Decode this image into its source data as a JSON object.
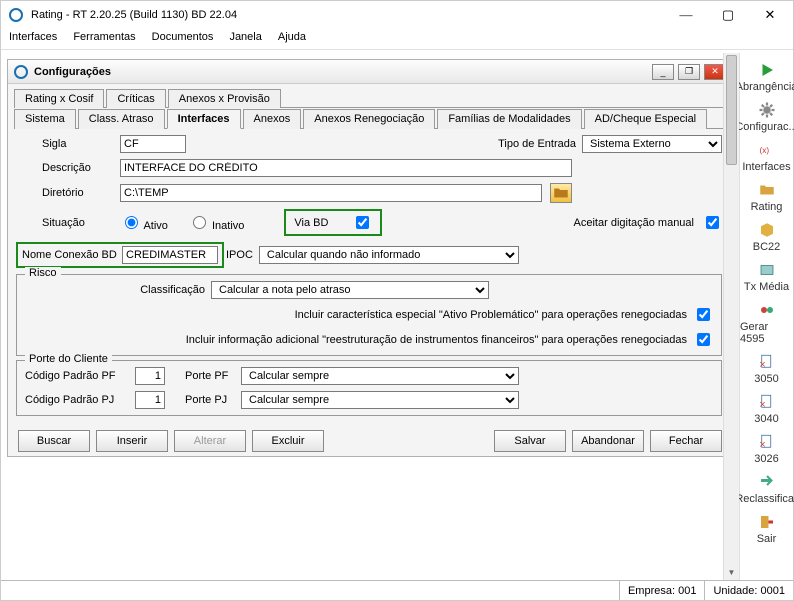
{
  "app": {
    "title": "Rating - RT 2.20.25 (Build 1130) BD 22.04"
  },
  "menus": [
    "Interfaces",
    "Ferramentas",
    "Documentos",
    "Janela",
    "Ajuda"
  ],
  "childTitle": "Configurações",
  "tabs1": [
    "Rating x Cosif",
    "Críticas",
    "Anexos x Provisão"
  ],
  "tabs2": [
    "Sistema",
    "Class. Atraso",
    "Interfaces",
    "Anexos",
    "Anexos Renegociação",
    "Famílias de Modalidades",
    "AD/Cheque Especial"
  ],
  "tabs2Active": "Interfaces",
  "form": {
    "siglaLbl": "Sigla",
    "sigla": "CF",
    "tipoEntradaLbl": "Tipo de Entrada",
    "tipoEntrada": "Sistema Externo",
    "descLbl": "Descrição",
    "desc": "INTERFACE DO CRÉDITO",
    "dirLbl": "Diretório",
    "dir": "C:\\TEMP",
    "sitLbl": "Situação",
    "ativo": "Ativo",
    "inativo": "Inativo",
    "viaBD": "Via BD",
    "aceitarManual": "Aceitar digitação manual",
    "nomeConLbl": "Nome Conexão BD",
    "nomeCon": "CREDIMASTER",
    "ipocLbl": "IPOC",
    "ipoc": "Calcular quando não informado",
    "riscoLegend": "Risco",
    "classifLbl": "Classificação",
    "classif": "Calcular a nota pelo atraso",
    "inc1": "Incluir característica especial \"Ativo Problemático\" para operações renegociadas",
    "inc2": "Incluir informação adicional \"reestruturação de instrumentos financeiros\" para operações renegociadas",
    "porteLegend": "Porte do Cliente",
    "codPF": "Código Padrão PF",
    "codPFv": "1",
    "portePF": "Porte PF",
    "portePFv": "Calcular sempre",
    "codPJ": "Código Padrão PJ",
    "codPJv": "1",
    "portePJ": "Porte PJ",
    "portePJv": "Calcular sempre"
  },
  "buttons": {
    "buscar": "Buscar",
    "inserir": "Inserir",
    "alterar": "Alterar",
    "excluir": "Excluir",
    "salvar": "Salvar",
    "abandonar": "Abandonar",
    "fechar": "Fechar"
  },
  "sidebar": [
    {
      "label": "Abrangência",
      "icon": "play"
    },
    {
      "label": "Configurac...",
      "icon": "gear"
    },
    {
      "label": "Interfaces",
      "icon": "io"
    },
    {
      "label": "Rating",
      "icon": "folder"
    },
    {
      "label": "BC22",
      "icon": "cube"
    },
    {
      "label": "Tx Média",
      "icon": "tx"
    },
    {
      "label": "Gerar 4595",
      "icon": "gen"
    },
    {
      "label": "3050",
      "icon": "doc"
    },
    {
      "label": "3040",
      "icon": "doc"
    },
    {
      "label": "3026",
      "icon": "doc"
    },
    {
      "label": "Reclassificar",
      "icon": "move"
    },
    {
      "label": "Sair",
      "icon": "exit"
    }
  ],
  "status": {
    "empresa": "Empresa: 001",
    "unidade": "Unidade: 0001"
  }
}
